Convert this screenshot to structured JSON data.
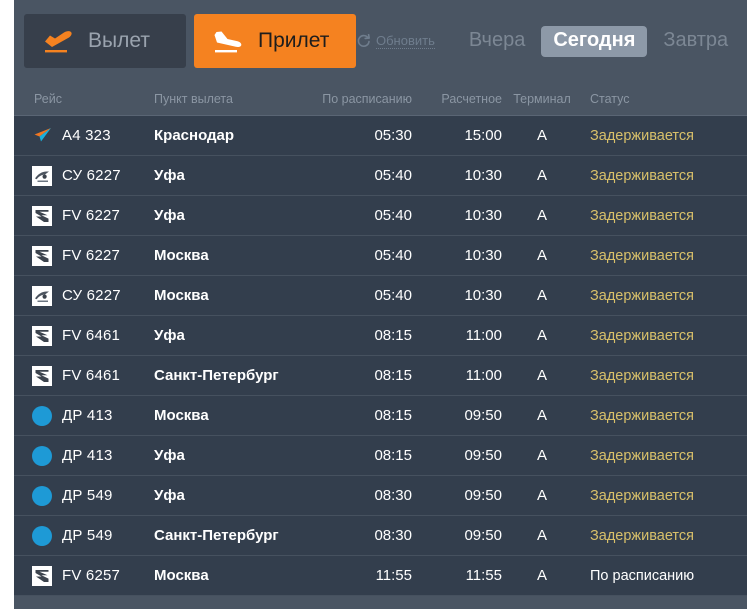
{
  "toolbar": {
    "tab_departure": "Вылет",
    "tab_arrival": "Прилет",
    "refresh_label": "Обновить",
    "day_yesterday": "Вчера",
    "day_today": "Сегодня",
    "day_tomorrow": "Завтра",
    "active_tab": "Прилет",
    "active_day": "Сегодня",
    "accent_color": "#f58220",
    "active_day_bg": "#8d99a8"
  },
  "table": {
    "headers": {
      "flight": "Рейс",
      "destination": "Пункт вылета",
      "scheduled": "По расписанию",
      "estimated": "Расчетное",
      "terminal": "Терминал",
      "status": "Статус"
    },
    "status_colors": {
      "delayed": "#d8c06a",
      "ontime": "#ffffff"
    },
    "rows": [
      {
        "logo": "azimuth-arrow-logo",
        "flight": "A4 323",
        "destination": "Краснодар",
        "scheduled": "05:30",
        "estimated": "15:00",
        "terminal": "A",
        "status": "Задерживается",
        "status_kind": "delayed"
      },
      {
        "logo": "aeroflot-logo",
        "flight": "СУ 6227",
        "destination": "Уфа",
        "scheduled": "05:40",
        "estimated": "10:30",
        "terminal": "A",
        "status": "Задерживается",
        "status_kind": "delayed"
      },
      {
        "logo": "rossiya-logo",
        "flight": "FV 6227",
        "destination": "Уфа",
        "scheduled": "05:40",
        "estimated": "10:30",
        "terminal": "A",
        "status": "Задерживается",
        "status_kind": "delayed"
      },
      {
        "logo": "rossiya-logo",
        "flight": "FV 6227",
        "destination": "Москва",
        "scheduled": "05:40",
        "estimated": "10:30",
        "terminal": "A",
        "status": "Задерживается",
        "status_kind": "delayed"
      },
      {
        "logo": "aeroflot-logo",
        "flight": "СУ 6227",
        "destination": "Москва",
        "scheduled": "05:40",
        "estimated": "10:30",
        "terminal": "A",
        "status": "Задерживается",
        "status_kind": "delayed"
      },
      {
        "logo": "rossiya-logo",
        "flight": "FV 6461",
        "destination": "Уфа",
        "scheduled": "08:15",
        "estimated": "11:00",
        "terminal": "A",
        "status": "Задерживается",
        "status_kind": "delayed"
      },
      {
        "logo": "rossiya-logo",
        "flight": "FV 6461",
        "destination": "Санкт-Петербург",
        "scheduled": "08:15",
        "estimated": "11:00",
        "terminal": "A",
        "status": "Задерживается",
        "status_kind": "delayed"
      },
      {
        "logo": "pobeda-logo",
        "flight": "ДР 413",
        "destination": "Москва",
        "scheduled": "08:15",
        "estimated": "09:50",
        "terminal": "A",
        "status": "Задерживается",
        "status_kind": "delayed"
      },
      {
        "logo": "pobeda-logo",
        "flight": "ДР 413",
        "destination": "Уфа",
        "scheduled": "08:15",
        "estimated": "09:50",
        "terminal": "A",
        "status": "Задерживается",
        "status_kind": "delayed"
      },
      {
        "logo": "pobeda-logo",
        "flight": "ДР 549",
        "destination": "Уфа",
        "scheduled": "08:30",
        "estimated": "09:50",
        "terminal": "A",
        "status": "Задерживается",
        "status_kind": "delayed"
      },
      {
        "logo": "pobeda-logo",
        "flight": "ДР 549",
        "destination": "Санкт-Петербург",
        "scheduled": "08:30",
        "estimated": "09:50",
        "terminal": "A",
        "status": "Задерживается",
        "status_kind": "delayed"
      },
      {
        "logo": "rossiya-logo",
        "flight": "FV 6257",
        "destination": "Москва",
        "scheduled": "11:55",
        "estimated": "11:55",
        "terminal": "A",
        "status": "По расписанию",
        "status_kind": "ontime"
      }
    ]
  }
}
